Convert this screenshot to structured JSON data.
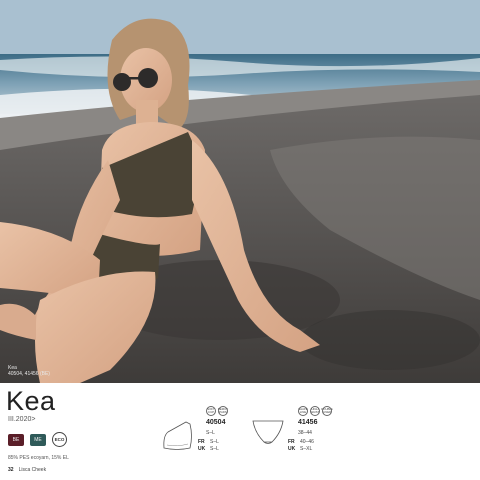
{
  "photo": {
    "caption_name": "Kea",
    "caption_codes": "40504, 41456 (BE)"
  },
  "product": {
    "name": "Kea",
    "collection": "III.2020>",
    "material": "85% PES ecoyarn, 15% EL"
  },
  "swatches": [
    {
      "code": "BE",
      "color": "#5a1e28"
    },
    {
      "code": "ME",
      "color": "#2f5a59"
    }
  ],
  "eco_label": "ECO",
  "footer": {
    "page_number": "32",
    "section": "Lisca Cheek"
  },
  "articles": [
    {
      "number": "40504",
      "badges": [
        "SOFT CUP",
        "REMOV PADS"
      ],
      "size_main": "S–L",
      "fr_label": "FR",
      "fr_sizes": "S–L",
      "uk_label": "UK",
      "uk_sizes": "S–L"
    },
    {
      "number": "41456",
      "badges": [
        "SHAPE LINE",
        "HIGH WAIST",
        "DOUBLE LINED"
      ],
      "size_main": "38–44",
      "fr_label": "FR",
      "fr_sizes": "40–46",
      "uk_label": "UK",
      "uk_sizes": "S–XL"
    }
  ]
}
